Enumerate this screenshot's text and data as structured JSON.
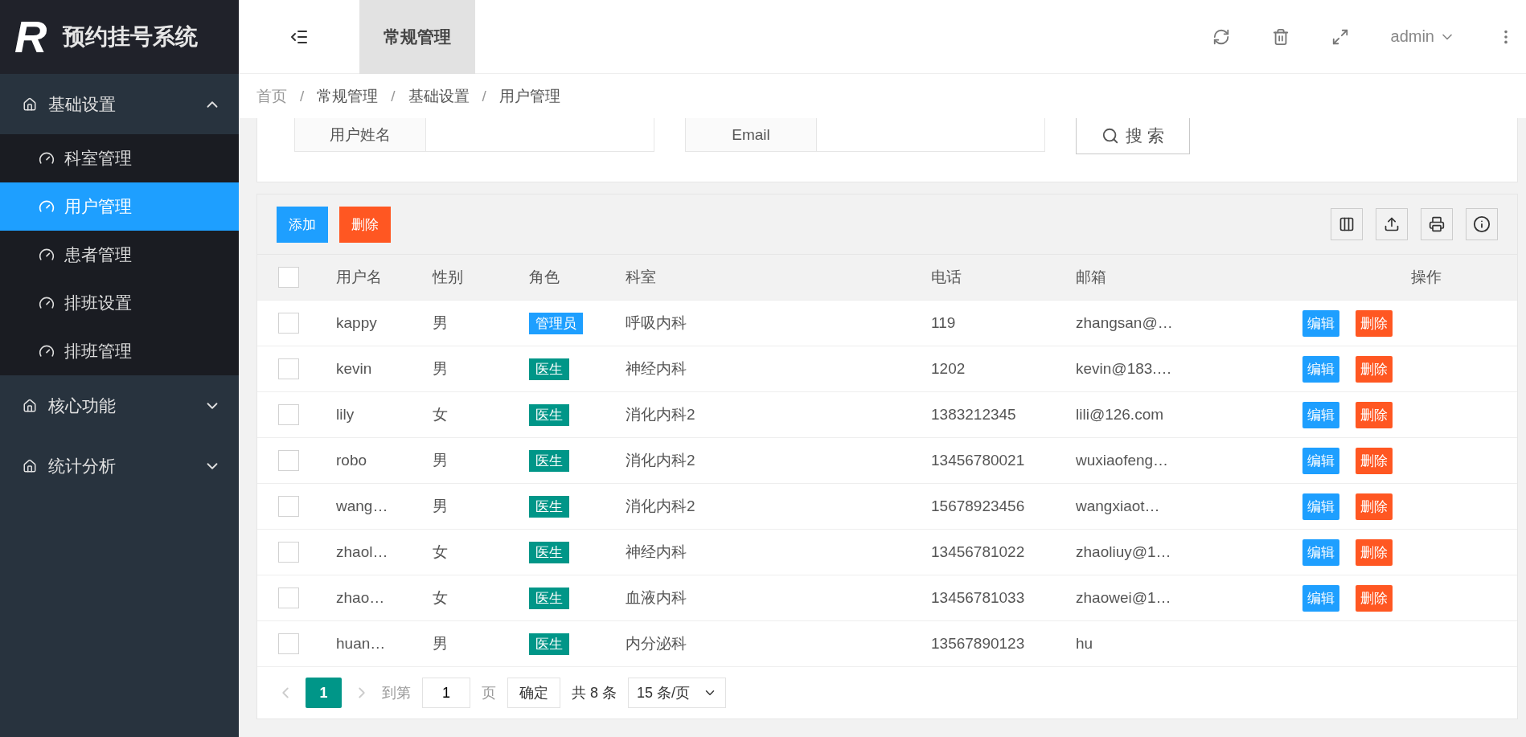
{
  "logo": {
    "mark": "R",
    "title": "预约挂号系统"
  },
  "sidebar": {
    "groups": [
      {
        "label": "基础设置",
        "expanded": true,
        "items": [
          {
            "label": "科室管理",
            "selected": false
          },
          {
            "label": "用户管理",
            "selected": true
          },
          {
            "label": "患者管理",
            "selected": false
          },
          {
            "label": "排班设置",
            "selected": false
          },
          {
            "label": "排班管理",
            "selected": false
          }
        ]
      },
      {
        "label": "核心功能",
        "expanded": false
      },
      {
        "label": "统计分析",
        "expanded": false
      }
    ]
  },
  "header": {
    "tabs": [
      {
        "label": "常规管理",
        "selected": true
      }
    ],
    "user": "admin"
  },
  "breadcrumb": [
    {
      "text": "首页",
      "kind": "link"
    },
    {
      "text": "/",
      "kind": "separator"
    },
    {
      "text": "常规管理",
      "kind": "link"
    },
    {
      "text": "/",
      "kind": "separator"
    },
    {
      "text": "基础设置",
      "kind": "link"
    },
    {
      "text": "/",
      "kind": "separator"
    },
    {
      "text": "用户管理",
      "kind": "link"
    }
  ],
  "search_form": {
    "fields": [
      {
        "label": "用户姓名"
      },
      {
        "label": "Email"
      }
    ],
    "button": "搜 索"
  },
  "toolbar": {
    "buttons": [
      {
        "label": "添加",
        "kind": "primary"
      },
      {
        "label": "删除",
        "kind": "danger"
      }
    ]
  },
  "table": {
    "header_checked": false,
    "columns": [
      "用户名",
      "性别",
      "角色",
      "科室",
      "电话",
      "邮箱",
      "操作"
    ],
    "rows": [
      {
        "checked": false,
        "cells": [
          "kappy",
          "男",
          "管理员",
          "呼吸内科",
          "119",
          "zhangsan@…"
        ],
        "color": "#1e9fff",
        "actions": [
          "编辑",
          "删除"
        ]
      },
      {
        "checked": false,
        "cells": [
          "kevin",
          "男",
          "医生",
          "神经内科",
          "1202",
          "kevin@183.…"
        ],
        "color": "#009688",
        "actions": [
          "编辑",
          "删除"
        ]
      },
      {
        "checked": false,
        "cells": [
          "lily",
          "女",
          "医生",
          "消化内科2",
          "1383212345",
          "lili@126.com"
        ],
        "color": "#009688",
        "actions": [
          "编辑",
          "删除"
        ]
      },
      {
        "checked": false,
        "cells": [
          "robo",
          "男",
          "医生",
          "消化内科2",
          "13456780021",
          "wuxiaofeng…"
        ],
        "color": "#009688",
        "actions": [
          "编辑",
          "删除"
        ]
      },
      {
        "checked": false,
        "cells": [
          "wang…",
          "男",
          "医生",
          "消化内科2",
          "15678923456",
          "wangxiaot…"
        ],
        "color": "#009688",
        "actions": [
          "编辑",
          "删除"
        ]
      },
      {
        "checked": false,
        "cells": [
          "zhaol…",
          "女",
          "医生",
          "神经内科",
          "13456781022",
          "zhaoliuy@1…"
        ],
        "color": "#009688",
        "actions": [
          "编辑",
          "删除"
        ]
      },
      {
        "checked": false,
        "cells": [
          "zhao…",
          "女",
          "医生",
          "血液内科",
          "13456781033",
          "zhaowei@1…"
        ],
        "color": "#009688",
        "actions": [
          "编辑",
          "删除"
        ]
      },
      {
        "checked": false,
        "cells": [
          "huan…",
          "男",
          "医生",
          "内分泌科",
          "13567890123",
          "hu"
        ],
        "color": "#009688"
      }
    ]
  },
  "pagination": {
    "pages": [
      {
        "label": "1",
        "selected": true
      }
    ],
    "goto_label": "到第",
    "goto_value": "1",
    "page_unit": "页",
    "confirm": "确定",
    "total": "共 8 条",
    "page_size": "15 条/页"
  }
}
